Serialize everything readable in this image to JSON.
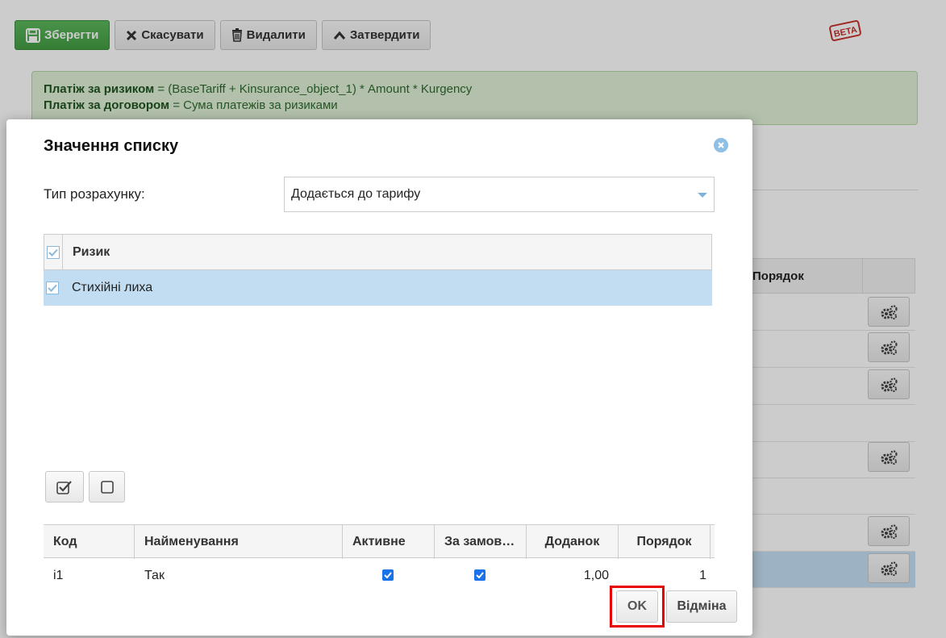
{
  "toolbar": {
    "save_label": "Зберегти",
    "cancel_label": "Скасувати",
    "delete_label": "Видалити",
    "approve_label": "Затвердити"
  },
  "beta_badge": "BETA",
  "formula": {
    "line1_bold": "Платіж за ризиком",
    "line1_rest": " = (BaseTariff + Kinsurance_object_1) * Amount * Kurgency",
    "line2_bold": "Платіж за договором",
    "line2_rest": " = Сума платежів за ризиками"
  },
  "background_table": {
    "order_header": "Порядок"
  },
  "dialog": {
    "title": "Значення списку",
    "calc_type_label": "Тип розрахунку:",
    "calc_type_value": "Додається до тарифу",
    "risk_grid": {
      "header": "Ризик",
      "rows": [
        {
          "label": "Стихійні лиха",
          "checked": true
        }
      ]
    },
    "values_grid": {
      "columns": [
        "Код",
        "Найменування",
        "Активне",
        "За замов…",
        "Доданок",
        "Порядок"
      ],
      "rows": [
        {
          "code": "i1",
          "name": "Так",
          "active": true,
          "default": true,
          "addend": "1,00",
          "order": "1"
        }
      ]
    },
    "ok_label": "OK",
    "cancel_label": "Відміна"
  },
  "colors": {
    "primary_green": "#5cb85c",
    "formula_bg": "#dff0d8",
    "selection_blue": "#c2ddf1",
    "focus_red": "#e60000"
  }
}
